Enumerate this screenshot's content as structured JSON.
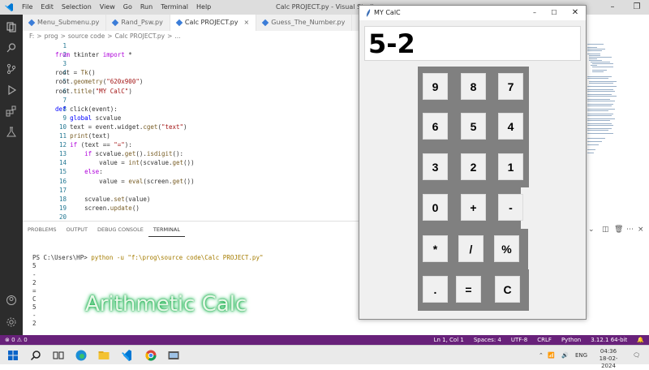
{
  "vscode": {
    "menu": [
      "File",
      "Edit",
      "Selection",
      "View",
      "Go",
      "Run",
      "Terminal",
      "Help"
    ],
    "window_title": "Calc PROJECT.py - Visual Studio",
    "tabs": [
      {
        "label": "Menu_Submenu.py",
        "active": false
      },
      {
        "label": "Rand_Psw.py",
        "active": false
      },
      {
        "label": "Calc PROJECT.py",
        "active": true,
        "close": "×"
      },
      {
        "label": "Guess_The_Number.py",
        "active": false
      }
    ],
    "breadcrumb": [
      "F:",
      ">",
      "prog",
      ">",
      "source code",
      ">",
      "Calc PROJECT.py",
      ">",
      "..."
    ],
    "editor": {
      "line_numbers": [
        "1",
        "2",
        "3",
        "4",
        "5",
        "6",
        "7",
        "8",
        "9",
        "10",
        "11",
        "12",
        "13",
        "14",
        "15",
        "16",
        "17",
        "18",
        "19",
        "20"
      ],
      "lines": [
        "",
        "from tkinter import *",
        "",
        "root = Tk()",
        "root.geometry(\"620x900\")",
        "root.title(\"MY CalC\")",
        "",
        "def click(event):",
        "    global scvalue",
        "    text = event.widget.cget(\"text\")",
        "    print(text)",
        "    if (text == \"=\"):",
        "        if scvalue.get().isdigit():",
        "            value = int(scvalue.get())",
        "        else:",
        "            value = eval(screen.get())",
        "",
        "        scvalue.set(value)",
        "        screen.update()",
        ""
      ]
    },
    "panel_tabs": [
      "PROBLEMS",
      "OUTPUT",
      "DEBUG CONSOLE",
      "TERMINAL"
    ],
    "terminal": {
      "prompt": "PS C:\\Users\\HP>",
      "command": "python -u \"f:\\prog\\source code\\Calc PROJECT.py\"",
      "output": [
        "5",
        "-",
        "2",
        "=",
        "C",
        "5",
        "-",
        "2"
      ]
    },
    "overlay_text": "Arithmetic Calc",
    "status": {
      "left": [
        "⊗ 0 ⚠ 0"
      ],
      "right": [
        "Ln 1, Col 1",
        "Spaces: 4",
        "UTF-8",
        "CRLF",
        "Python",
        "3.12.1 64-bit"
      ]
    },
    "taskbar": {
      "tray_lang": "ENG",
      "time": "04:36",
      "date": "18-02-2024"
    }
  },
  "calculator": {
    "title": "MY CalC",
    "display": "5-2",
    "rows": [
      [
        "9",
        "8",
        "7"
      ],
      [
        "6",
        "5",
        "4"
      ],
      [
        "3",
        "2",
        "1"
      ],
      [
        "0",
        "+",
        "-"
      ],
      [
        "*",
        "/",
        "%"
      ],
      [
        ".",
        "=",
        "C"
      ]
    ]
  },
  "colors": {
    "status_bar": "#68217a",
    "activity_bar": "#2c2c2c",
    "calc_frame": "#808080",
    "overlay_glow": "#1aa84a"
  }
}
